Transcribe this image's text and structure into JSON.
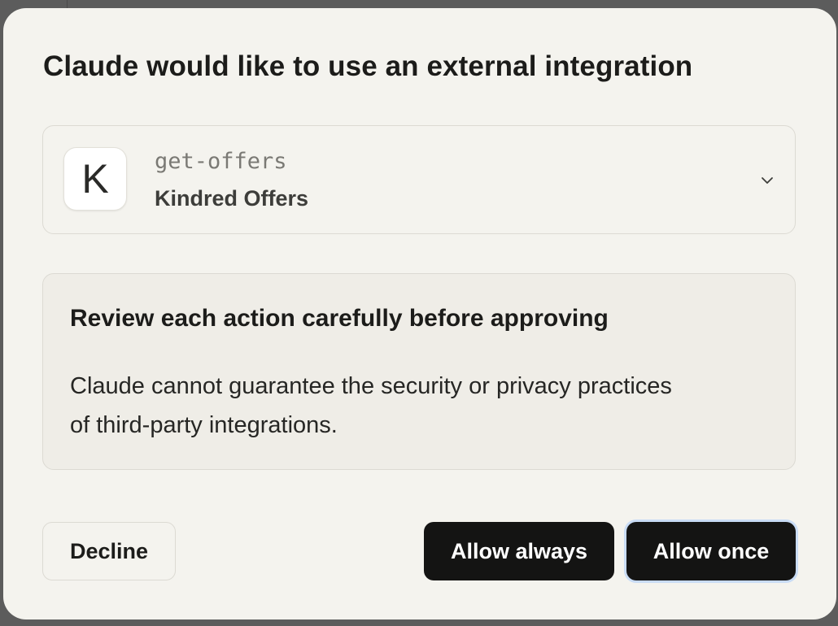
{
  "dialog": {
    "title": "Claude would like to use an external integration"
  },
  "tool": {
    "avatar_letter": "K",
    "name": "get-offers",
    "provider": "Kindred Offers",
    "expand_icon": "chevron-down-icon"
  },
  "warning": {
    "title": "Review each action carefully before approving",
    "body": "Claude cannot guarantee the security or privacy practices of third-party integrations."
  },
  "actions": {
    "decline_label": "Decline",
    "allow_always_label": "Allow always",
    "allow_once_label": "Allow once"
  },
  "colors": {
    "dialog_background": "#f4f3ee",
    "warning_background": "#efede7",
    "primary_button": "#141413",
    "focus_ring": "#c9dcf5"
  }
}
